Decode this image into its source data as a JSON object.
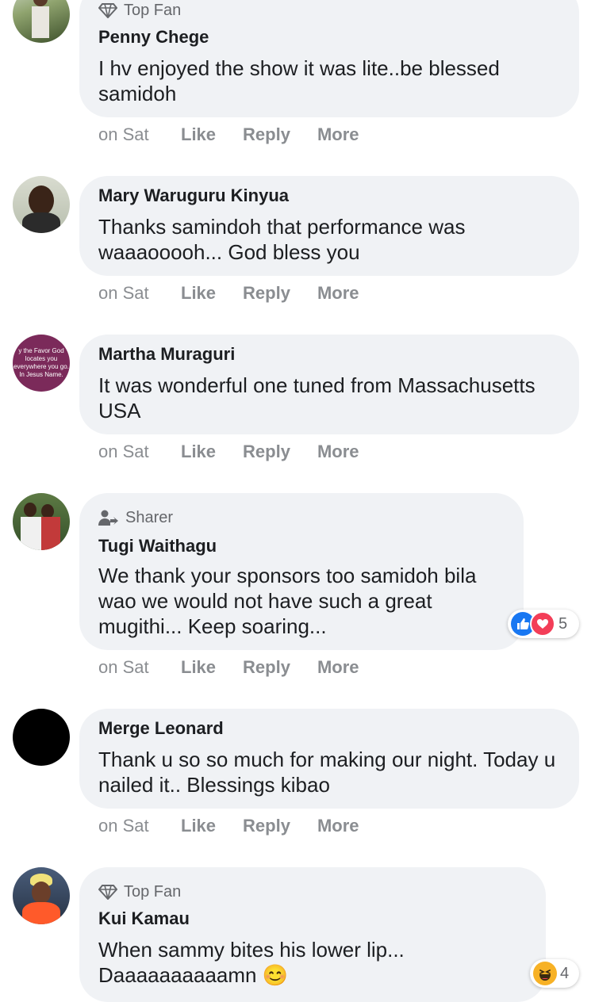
{
  "comments": [
    {
      "badge": "Top Fan",
      "name": "Penny Chege",
      "text": "I hv enjoyed the show it was lite..be blessed samidoh",
      "time": "on Sat",
      "like": "Like",
      "reply": "Reply",
      "more": "More"
    },
    {
      "badge": "",
      "name": "Mary Waruguru Kinyua",
      "text": "Thanks samindoh that performance was waaaooooh... God bless you",
      "time": "on Sat",
      "like": "Like",
      "reply": "Reply",
      "more": "More"
    },
    {
      "badge": "",
      "name": "Martha Muraguri",
      "text": "It was wonderful one tuned from Massachusetts USA",
      "time": "on Sat",
      "like": "Like",
      "reply": "Reply",
      "more": "More",
      "avatar_text": "y the Favor God locates you everywhere you go. In Jesus Name."
    },
    {
      "badge": "Sharer",
      "name": "Tugi Waithagu",
      "text": "We thank your sponsors too samidoh bila wao we would not have such a great mugithi... Keep soaring...",
      "time": "on Sat",
      "like": "Like",
      "reply": "Reply",
      "more": "More",
      "reactions": "5"
    },
    {
      "badge": "",
      "name": "Merge Leonard",
      "text": "Thank u so so much for making our night. Today u nailed it.. Blessings kibao",
      "time": "on Sat",
      "like": "Like",
      "reply": "Reply",
      "more": "More"
    },
    {
      "badge": "Top Fan",
      "name": "Kui Kamau",
      "text": "When sammy bites his lower lip... Daaaaaaaaaamn",
      "emoji": "😊",
      "reactions": "4"
    }
  ],
  "colors": {
    "bubble": "#f0f2f5",
    "like_blue": "#1877f2",
    "love_red": "#f33e58",
    "haha_yellow": "#f7b125"
  }
}
